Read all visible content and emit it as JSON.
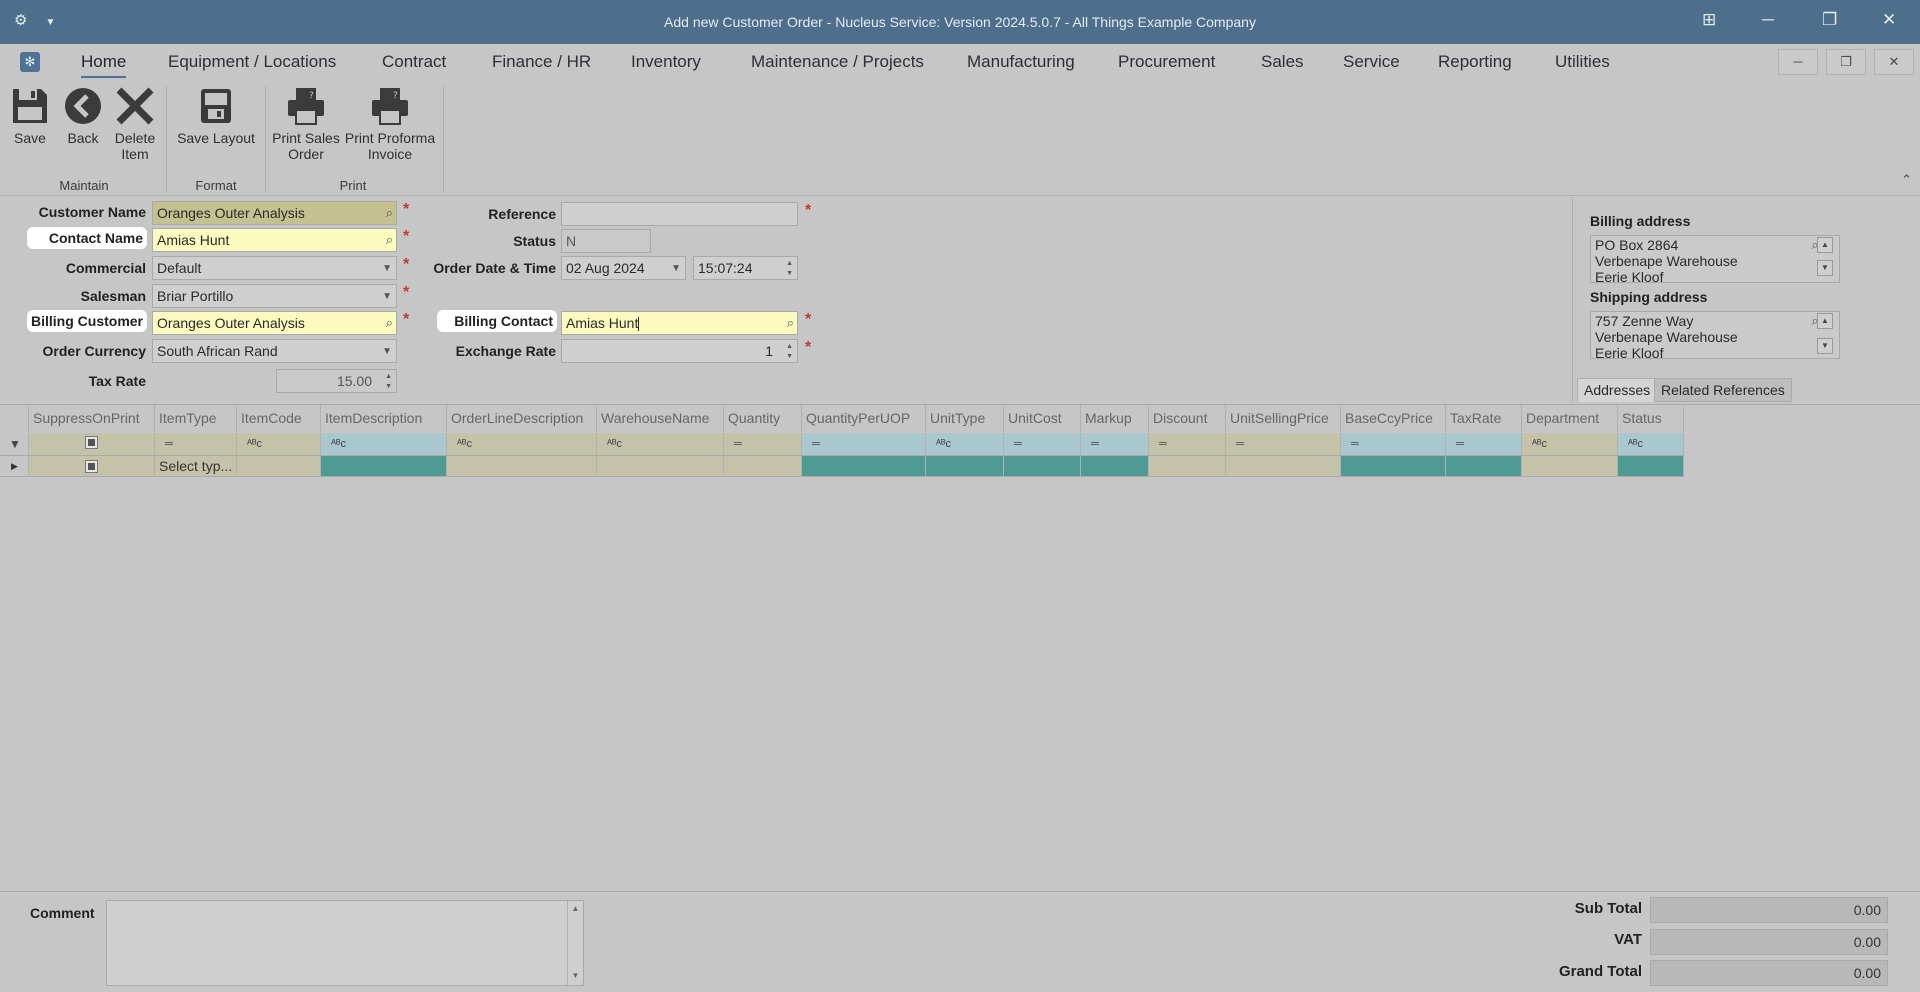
{
  "window": {
    "title": "Add new Customer Order - Nucleus Service: Version 2024.5.0.7 - All Things Example Company"
  },
  "menu": {
    "items": [
      "Home",
      "Equipment / Locations",
      "Contract",
      "Finance / HR",
      "Inventory",
      "Maintenance / Projects",
      "Manufacturing",
      "Procurement",
      "Sales",
      "Service",
      "Reporting",
      "Utilities"
    ],
    "active": "Home"
  },
  "ribbon": {
    "save": "Save",
    "back": "Back",
    "delete_1": "Delete",
    "delete_2": "Item",
    "save_layout": "Save Layout",
    "print_sales_1": "Print Sales",
    "print_sales_2": "Order",
    "print_proforma_1": "Print Proforma",
    "print_proforma_2": "Invoice",
    "group_maintain": "Maintain",
    "group_format": "Format",
    "group_print": "Print"
  },
  "form": {
    "customer_name_label": "Customer Name",
    "customer_name": "Oranges Outer Analysis",
    "contact_name_label": "Contact Name",
    "contact_name": "Amias Hunt",
    "commercial_label": "Commercial",
    "commercial": "Default",
    "salesman_label": "Salesman",
    "salesman": "Briar Portillo",
    "billing_customer_label": "Billing Customer",
    "billing_customer": "Oranges Outer Analysis",
    "order_currency_label": "Order Currency",
    "order_currency": "South African Rand",
    "tax_rate_label": "Tax Rate",
    "tax_rate": "15.00",
    "reference_label": "Reference",
    "reference": "",
    "status_label": "Status",
    "status": "N",
    "order_date_label": "Order Date & Time",
    "order_date": "02 Aug 2024",
    "order_time": "15:07:24",
    "billing_contact_label": "Billing Contact",
    "billing_contact": "Amias Hunt",
    "exchange_rate_label": "Exchange Rate",
    "exchange_rate": "1"
  },
  "addresses": {
    "billing_label": "Billing address",
    "billing_lines": [
      "PO Box 2864",
      "Verbenape Warehouse",
      "Eerie Kloof"
    ],
    "shipping_label": "Shipping address",
    "shipping_lines": [
      "757 Zenne Way",
      "Verbenape Warehouse",
      "Eerie Kloof"
    ],
    "tabs": [
      "Addresses",
      "Related References"
    ]
  },
  "grid": {
    "columns": [
      "SuppressOnPrint",
      "ItemType",
      "ItemCode",
      "ItemDescription",
      "OrderLineDescription",
      "WarehouseName",
      "Quantity",
      "QuantityPerUOP",
      "UnitType",
      "UnitCost",
      "Markup",
      "Discount",
      "UnitSellingPrice",
      "BaseCcyPrice",
      "TaxRate",
      "Department",
      "Status"
    ],
    "new_row_itemtype": "Select typ..."
  },
  "footer": {
    "comment_label": "Comment",
    "sub_total_label": "Sub Total",
    "sub_total": "0.00",
    "vat_label": "VAT",
    "vat": "0.00",
    "grand_total_label": "Grand Total",
    "grand_total": "0.00"
  }
}
